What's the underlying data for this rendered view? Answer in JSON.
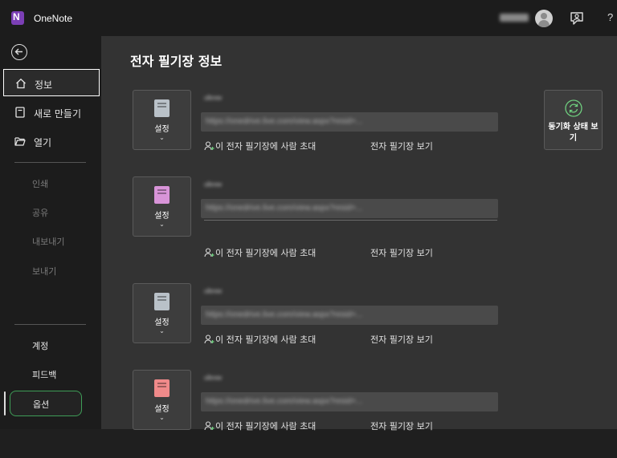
{
  "app": {
    "name": "OneNote",
    "user_name": "▒▒▒",
    "help": "?"
  },
  "sidebar": {
    "nav": [
      {
        "label": "정보"
      },
      {
        "label": "새로 만들기"
      },
      {
        "label": "열기"
      }
    ],
    "disabled": [
      {
        "label": "인쇄"
      },
      {
        "label": "공유"
      },
      {
        "label": "내보내기"
      },
      {
        "label": "보내기"
      }
    ],
    "bottom": [
      {
        "label": "계정"
      },
      {
        "label": "피드백"
      },
      {
        "label": "옵션"
      }
    ]
  },
  "main": {
    "title": "전자 필기장 정보",
    "sync_button_label": "동기화 상태 보기",
    "notebooks": [
      {
        "name": "ᵘˡᵇʳᵉʷ",
        "url": "https://onedrive.live.com/view.aspx?resid=...",
        "settings_label": "설정",
        "invite_label": "이 전자 필기장에 사람 초대",
        "view_label": "전자 필기장 보기",
        "icon_color": "#b9c1c8"
      },
      {
        "name": "ᵘˡᵇʳᵉʷ",
        "url": "https://onedrive.live.com/view.aspx?resid=...",
        "settings_label": "설정",
        "invite_label": "이 전자 필기장에 사람 초대",
        "view_label": "전자 필기장 보기",
        "icon_color": "#d894d8"
      },
      {
        "name": "ᵘˡᵇʳᵉʷ",
        "url": "https://onedrive.live.com/view.aspx?resid=...",
        "settings_label": "설정",
        "invite_label": "이 전자 필기장에 사람 초대",
        "view_label": "전자 필기장 보기",
        "icon_color": "#b9c1c8"
      },
      {
        "name": "ᵘˡᵇʳᵉʷ",
        "url": "https://onedrive.live.com/view.aspx?resid=...",
        "settings_label": "설정",
        "invite_label": "이 전자 필기장에 사람 초대",
        "view_label": "전자 필기장 보기",
        "icon_color": "#f08a8a"
      }
    ]
  },
  "colors": {
    "accent_green": "#3e9d57",
    "sync_icon": "#6fcf7f",
    "selected_border": "#ffffff"
  }
}
